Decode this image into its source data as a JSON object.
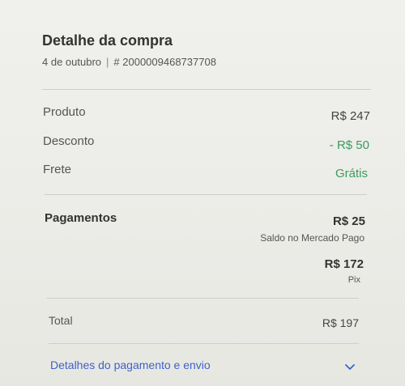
{
  "header": {
    "title": "Detalhe da compra",
    "date": "4 de outubro",
    "separator": "|",
    "order_number": "# 2000009468737708"
  },
  "summary": {
    "product_label": "Produto",
    "product_value": "R$ 247",
    "discount_label": "Desconto",
    "discount_value": "- R$ 50",
    "shipping_label": "Frete",
    "shipping_value": "Grátis"
  },
  "payments": {
    "label": "Pagamentos",
    "items": [
      {
        "amount": "R$ 25",
        "method": "Saldo no Mercado Pago"
      },
      {
        "amount": "R$ 172",
        "method": "Pix"
      }
    ]
  },
  "total": {
    "label": "Total",
    "value": "R$ 197"
  },
  "footer": {
    "details_link": "Detalhes do pagamento e envio",
    "chevron_icon": "chevron-down-icon"
  },
  "colors": {
    "accent_green": "#3a9b5e",
    "link_blue": "#3e63c9"
  }
}
